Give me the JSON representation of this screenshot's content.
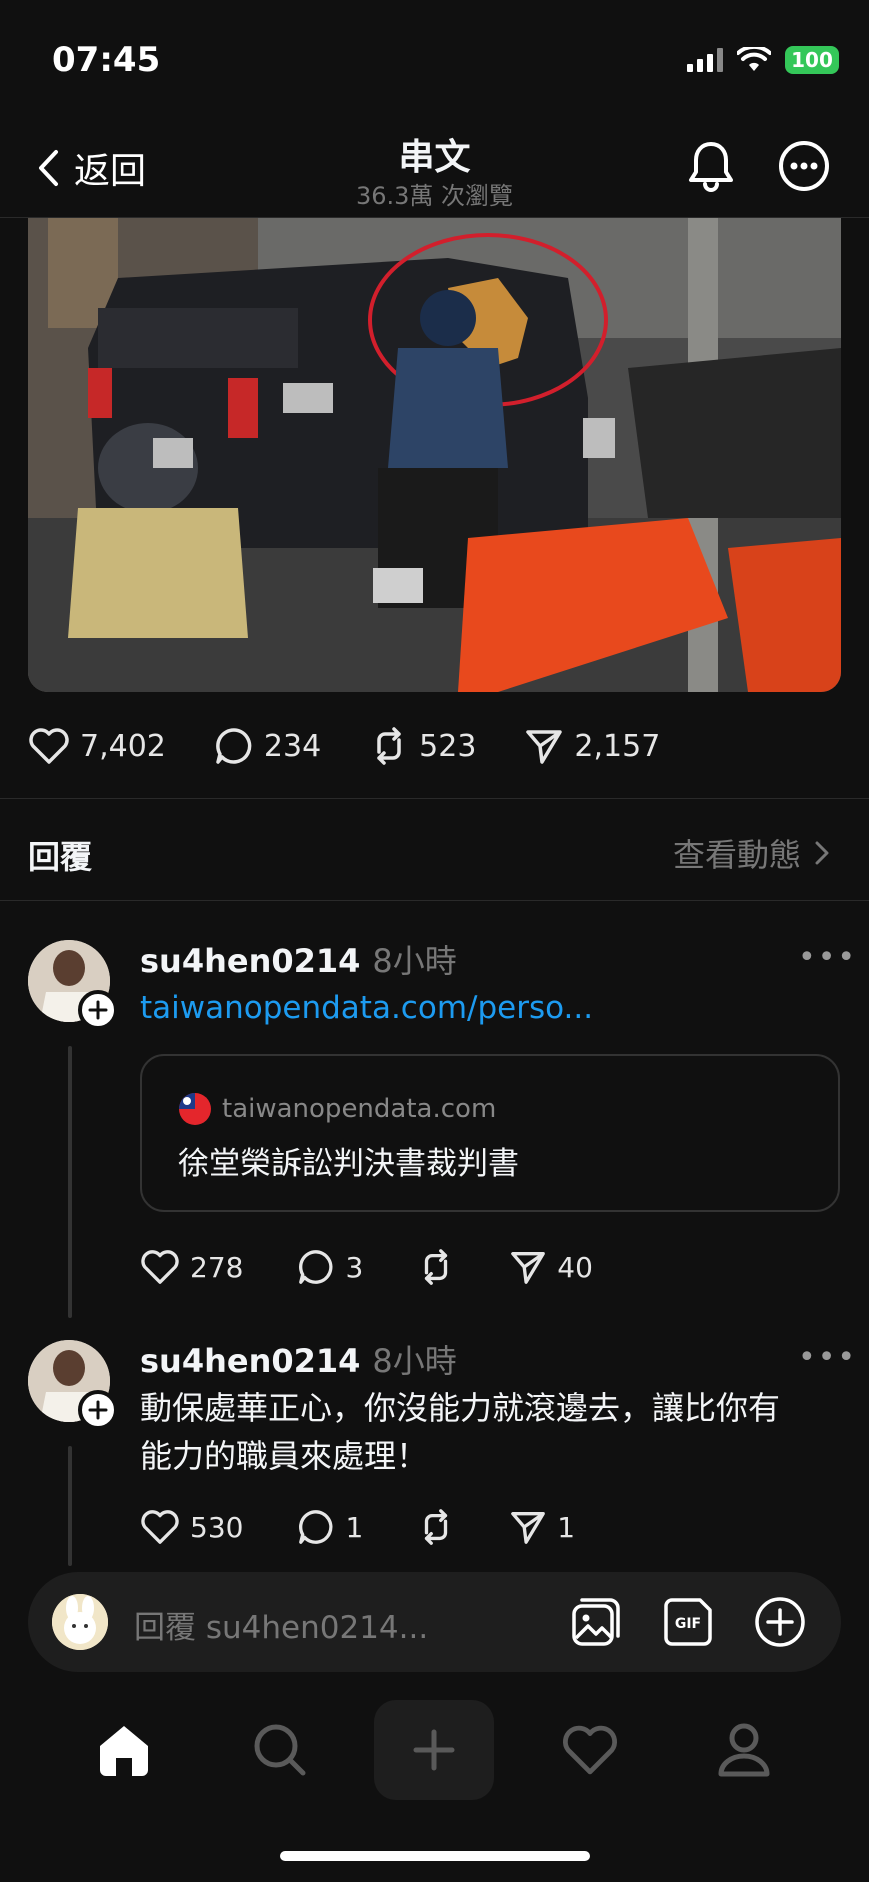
{
  "status_bar": {
    "time": "07:45",
    "battery": "100"
  },
  "header": {
    "back_label": "返回",
    "title": "串文",
    "subtitle": "36.3萬 次瀏覽"
  },
  "post": {
    "stats": {
      "likes": "7,402",
      "comments": "234",
      "reposts": "523",
      "shares": "2,157"
    }
  },
  "replies": {
    "title": "回覆",
    "view_activity": "查看動態"
  },
  "comments": [
    {
      "username": "su4hen0214",
      "time": "8小時",
      "link": "taiwanopendata.com/perso...",
      "card": {
        "domain": "taiwanopendata.com",
        "title": "徐堂榮訴訟判決書裁判書"
      },
      "stats": {
        "likes": "278",
        "comments": "3",
        "shares": "40"
      }
    },
    {
      "username": "su4hen0214",
      "time": "8小時",
      "text_line1": "動保處華正心，你沒能力就滾邊去，讓比你有",
      "text_line2": "能力的職員來處理！",
      "stats": {
        "likes": "530",
        "comments": "1",
        "shares": "1"
      }
    }
  ],
  "reply_bar": {
    "placeholder": "回覆 su4hen0214..."
  },
  "colors": {
    "background": "#101010",
    "link": "#1d9bf0",
    "battery": "#34c759"
  }
}
